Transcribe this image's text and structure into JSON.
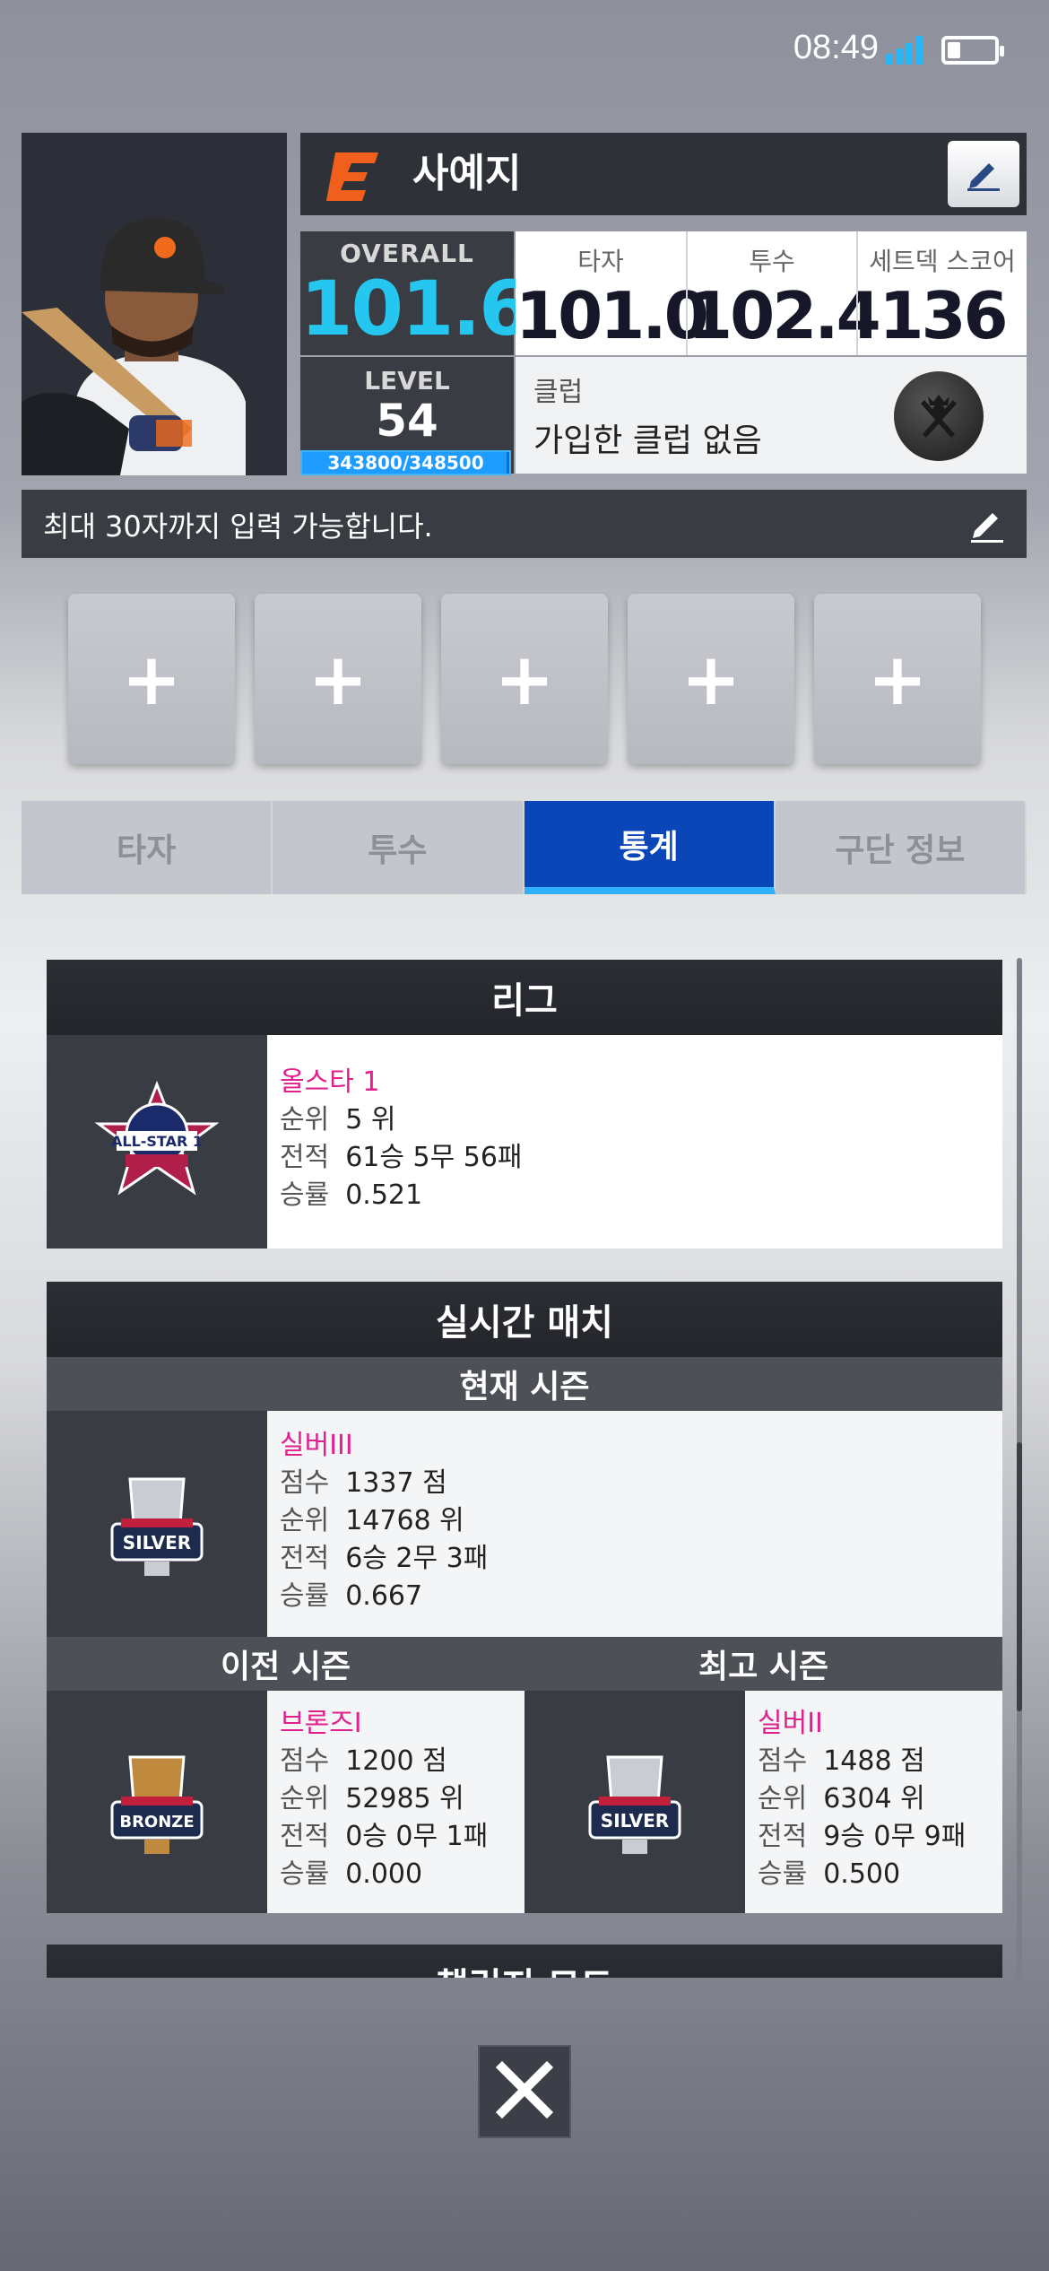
{
  "status_bar": {
    "time": "08:49"
  },
  "profile": {
    "name": "사예지",
    "overall_label": "OVERALL",
    "overall_value": "101.6",
    "level_label": "LEVEL",
    "level_value": "54",
    "exp_text": "343800/348500",
    "exp_progress": 0.9865,
    "stats": [
      {
        "label": "타자",
        "value": "101.0"
      },
      {
        "label": "투수",
        "value": "102.4"
      },
      {
        "label": "세트덱 스코어",
        "value": "136"
      }
    ],
    "club_label": "클럽",
    "club_value": "가입한 클럽 없음",
    "comment_placeholder": "최대 30자까지 입력 가능합니다."
  },
  "slots": [
    "+",
    "+",
    "+",
    "+",
    "+"
  ],
  "tabs": [
    {
      "label": "타자",
      "active": false
    },
    {
      "label": "투수",
      "active": false
    },
    {
      "label": "통계",
      "active": true
    },
    {
      "label": "구단 정보",
      "active": false
    }
  ],
  "league": {
    "title": "리그",
    "tier": "올스타 1",
    "rows": [
      {
        "k": "순위",
        "v": "5 위"
      },
      {
        "k": "전적",
        "v": "61승 5무 56패"
      },
      {
        "k": "승률",
        "v": "0.521"
      }
    ]
  },
  "realtime": {
    "title": "실시간 매치",
    "current": {
      "title": "현재 시즌",
      "tier": "실버III",
      "rows": [
        {
          "k": "점수",
          "v": "1337 점"
        },
        {
          "k": "순위",
          "v": "14768 위"
        },
        {
          "k": "전적",
          "v": "6승 2무 3패"
        },
        {
          "k": "승률",
          "v": "0.667"
        }
      ]
    },
    "previous": {
      "title": "이전 시즌",
      "tier": "브론즈I",
      "rows": [
        {
          "k": "점수",
          "v": "1200 점"
        },
        {
          "k": "순위",
          "v": "52985 위"
        },
        {
          "k": "전적",
          "v": "0승 0무 1패"
        },
        {
          "k": "승률",
          "v": "0.000"
        }
      ]
    },
    "best": {
      "title": "최고 시즌",
      "tier": "실버II",
      "rows": [
        {
          "k": "점수",
          "v": "1488 점"
        },
        {
          "k": "순위",
          "v": "6304 위"
        },
        {
          "k": "전적",
          "v": "9승 0무 9패"
        },
        {
          "k": "승률",
          "v": "0.500"
        }
      ]
    }
  },
  "challenge": {
    "title": "챌린지 모드"
  },
  "icons": {
    "edit": "pencil-icon",
    "close": "close-icon",
    "club": "crossed-bats-icon"
  },
  "colors": {
    "accent_blue": "#0a46b8",
    "overall_cyan": "#25c6f0",
    "tier_pink": "#e0208c"
  }
}
